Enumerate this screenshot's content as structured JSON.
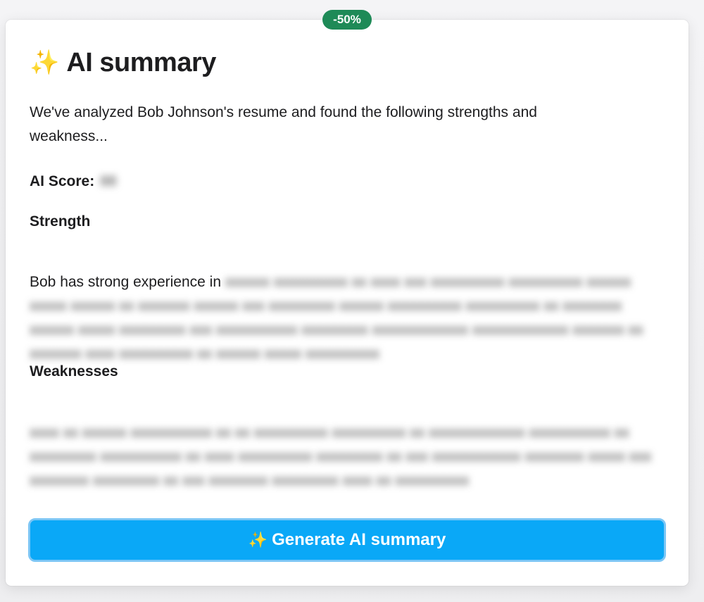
{
  "badge": {
    "label": "-50%"
  },
  "summary": {
    "title": "AI summary",
    "intro": "We've analyzed Bob Johnson's resume and found the following strengths and weakness...",
    "score_label": "AI Score:",
    "score_value": "88",
    "strength_heading": "Strength",
    "strength_visible": "Bob has strong experience in",
    "strength_blurred": "xxxxxx xxxxxxxxxx xx xxxx xxx xxxxxxxxxx xxxxxxxxxx xxxxxx xxxxx xxxxxx xx xxxxxxx xxxxxx xxx xxxxxxxxx xxxxxx xxxxxxxxxx xxxxxxxxxx xx xxxxxxxx xxxxxx xxxxx xxxxxxxxx xxx xxxxxxxxxxx xxxxxxxxx xxxxxxxxxxxxx xxxxxxxxxxxxx xxxxxxx xx xxxxxxx xxxx xxxxxxxxxx xx xxxxxx xxxxx xxxxxxxxxx",
    "weakness_heading": "Weaknesses",
    "weakness_blurred": "xxxx xx xxxxxx xxxxxxxxxxx xx xx xxxxxxxxxx xxxxxxxxxx xx xxxxxxxxxxxxx xxxxxxxxxxx xx xxxxxxxxx xxxxxxxxxxx xx xxxx xxxxxxxxxx xxxxxxxxx xx xxx xxxxxxxxxxxx xxxxxxxx xxxxx xxx xxxxxxxx xxxxxxxxx xx xxx xxxxxxxx xxxxxxxxx xxxx xx xxxxxxxxxx"
  },
  "button": {
    "label": "Generate AI summary",
    "icon": "sparkles-icon"
  },
  "colors": {
    "badge": "#1e8a57",
    "button": "#0aa8f7",
    "sparkle": "#f3c020"
  }
}
